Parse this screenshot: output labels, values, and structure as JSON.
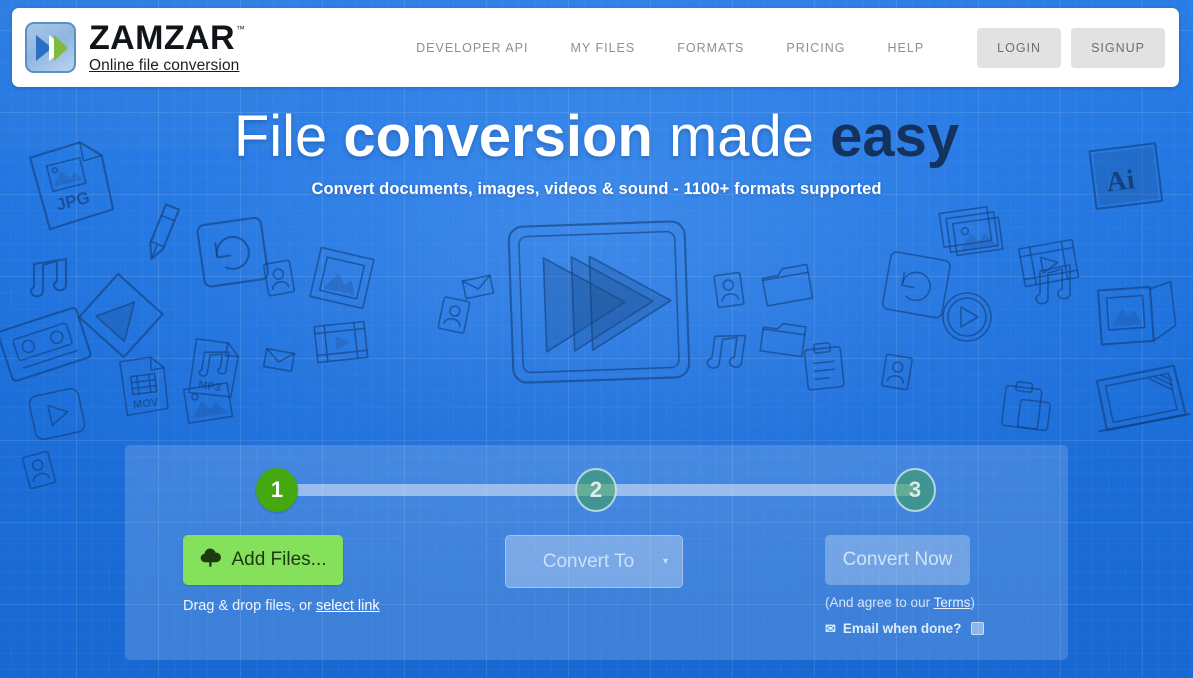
{
  "brand": {
    "name": "ZAMZAR",
    "trademark": "™",
    "tagline": "Online file conversion",
    "logo_icon": "double-chevron-play-icon",
    "logo_blue": "#4a86c8",
    "logo_green": "#7fb93f"
  },
  "nav": {
    "items": [
      {
        "label": "DEVELOPER API",
        "name": "nav-developer-api"
      },
      {
        "label": "MY FILES",
        "name": "nav-my-files"
      },
      {
        "label": "FORMATS",
        "name": "nav-formats"
      },
      {
        "label": "PRICING",
        "name": "nav-pricing"
      },
      {
        "label": "HELP",
        "name": "nav-help"
      }
    ],
    "login_label": "LOGIN",
    "signup_label": "SIGNUP"
  },
  "hero": {
    "headline_part1": "File ",
    "headline_part2": "conversion",
    "headline_part3": " made ",
    "headline_part4": "easy",
    "subhead": "Convert documents, images, videos & sound - 1100+ formats supported"
  },
  "converter": {
    "steps": [
      {
        "number": "1",
        "state": "active"
      },
      {
        "number": "2",
        "state": "muted"
      },
      {
        "number": "3",
        "state": "muted"
      }
    ],
    "add_files_label": "Add Files...",
    "add_files_icon": "cloud-upload-icon",
    "drop_hint_prefix": "Drag & drop files, or ",
    "drop_hint_link": "select link",
    "convert_to_label": "Convert To",
    "convert_to_caret": "▾",
    "convert_now_label": "Convert Now",
    "terms_prefix": "(And agree to our ",
    "terms_link": "Terms",
    "terms_suffix": ")",
    "email_icon": "✉",
    "email_label": "Email when done?",
    "email_checked": false
  },
  "colors": {
    "background_blue": "#1d6fda",
    "background_blue_light": "#2a7de4",
    "accent_green": "#44a811",
    "button_green": "#85e05c",
    "headline_dark": "#15325e",
    "doodle_stroke": "#123f7d"
  }
}
